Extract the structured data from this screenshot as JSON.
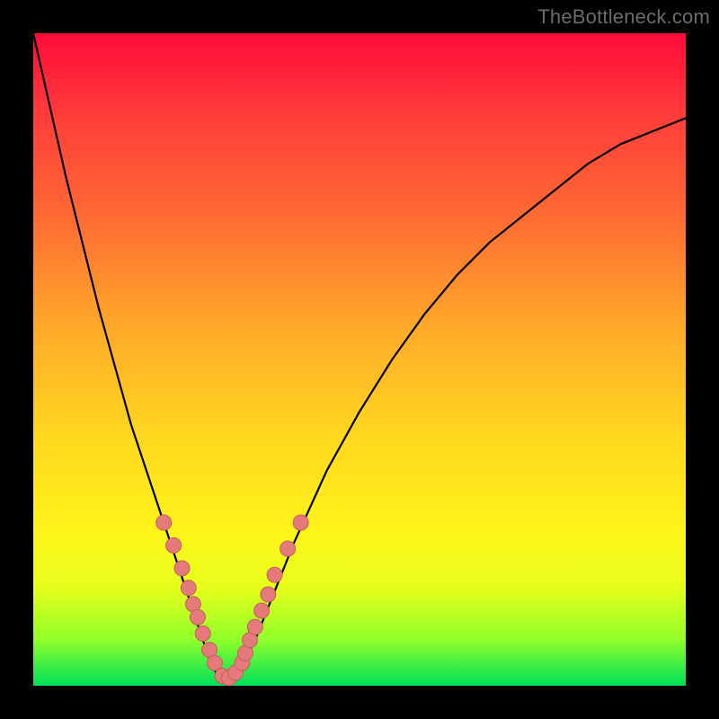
{
  "watermark": "TheBottleneck.com",
  "colors": {
    "frame_bg": "#000000",
    "curve_stroke": "#000000",
    "marker_fill": "#e47a7a",
    "marker_stroke": "#c95c5c"
  },
  "chart_data": {
    "type": "line",
    "title": "",
    "xlabel": "",
    "ylabel": "",
    "xlim": [
      0,
      100
    ],
    "ylim": [
      0,
      100
    ],
    "grid": false,
    "series": [
      {
        "name": "bottleneck-curve",
        "x": [
          0,
          5,
          10,
          15,
          18,
          20,
          22,
          24,
          26,
          27,
          28,
          29,
          30,
          32,
          34,
          36,
          38,
          40,
          45,
          50,
          55,
          60,
          65,
          70,
          75,
          80,
          85,
          90,
          95,
          100
        ],
        "y": [
          100,
          78,
          58,
          40,
          31,
          25,
          19,
          13,
          7,
          4,
          2,
          1,
          1,
          3,
          7,
          12,
          17,
          22,
          33,
          42,
          50,
          57,
          63,
          68,
          72,
          76,
          80,
          83,
          85,
          87
        ]
      }
    ],
    "markers": {
      "name": "highlighted-points",
      "x": [
        20,
        21.5,
        22.8,
        23.8,
        24.5,
        25.2,
        26,
        27,
        27.8,
        29,
        30,
        31,
        32,
        32.5,
        33.2,
        34,
        35,
        36,
        37,
        39,
        41
      ],
      "y": [
        25,
        21.5,
        18,
        15,
        12.5,
        10.5,
        8,
        5.5,
        3.5,
        1.5,
        1.2,
        2,
        3.5,
        5,
        7,
        9,
        11.5,
        14,
        17,
        21,
        25
      ]
    }
  }
}
